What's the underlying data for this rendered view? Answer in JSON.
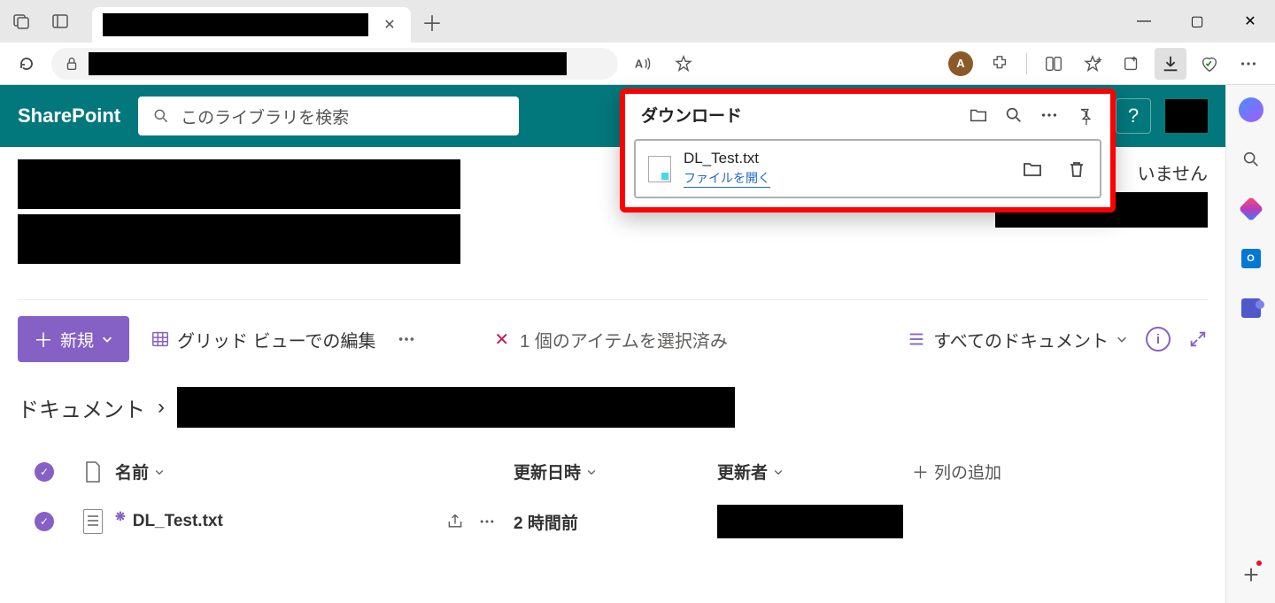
{
  "browser": {
    "window_controls": {
      "min": "—",
      "max": "▢",
      "close": "✕"
    }
  },
  "addr_icons": {
    "avatar_letter": "A"
  },
  "sharepoint": {
    "brand": "SharePoint",
    "search_placeholder": "このライブラリを検索",
    "help": "?",
    "follow_tail": "いません"
  },
  "commands": {
    "new": "新規",
    "grid": "グリッド ビューでの編集",
    "selected": "1 個のアイテムを選択済み",
    "viewname": "すべてのドキュメント"
  },
  "breadcrumb": {
    "root": "ドキュメント",
    "sep": "›"
  },
  "columns": {
    "name": "名前",
    "modified": "更新日時",
    "editor": "更新者",
    "add": "列の追加"
  },
  "rows": [
    {
      "name": "DL_Test.txt",
      "modified": "2 時間前"
    }
  ],
  "downloads": {
    "title": "ダウンロード",
    "file": "DL_Test.txt",
    "open": "ファイルを開く"
  },
  "rail": {
    "outlook_letter": "O"
  }
}
